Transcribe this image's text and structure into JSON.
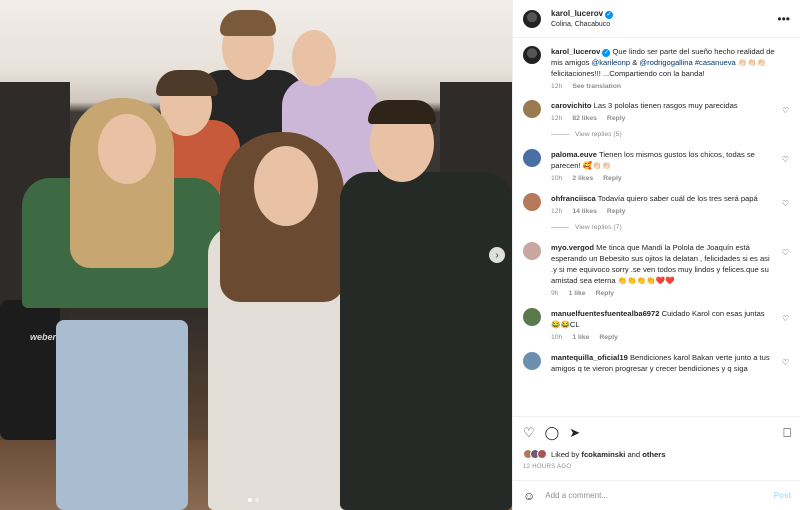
{
  "post": {
    "username": "karol_lucerov",
    "location": "Colina, Chacabuco",
    "caption": {
      "username": "karol_lucerov",
      "text_a": "Que lindo ser parte del sueño hecho realidad de mis amigos",
      "mention1": "@karileonp",
      "amp": "&",
      "mention2": "@rodrigogallina",
      "hashtag": "#casanueva",
      "text_b": "👏🏻👏🏻👏🏻 felicitaciones!!! ...Compartiendo con la banda!",
      "time": "12h",
      "see_translation": "See translation"
    }
  },
  "photo": {
    "grill_text": "weber",
    "next_icon": "chevron-right-icon"
  },
  "comments": [
    {
      "username": "carovichito",
      "text": "Las 3 pololas tienen rasgos muy parecidas",
      "time": "12h",
      "likes": "82 likes",
      "reply": "Reply",
      "view_replies": "View replies (5)",
      "avatar_color": "#9a7b4f"
    },
    {
      "username": "paloma.euve",
      "text": "Tienen los mismos gustos los chicos, todas se parecen! 🥰👏🏻👏🏻",
      "time": "10h",
      "likes": "2 likes",
      "reply": "Reply",
      "view_replies": "",
      "avatar_color": "#4a6fa5"
    },
    {
      "username": "ohfranciisca",
      "text": "Todavía quiero saber cuál de los tres será papá",
      "time": "12h",
      "likes": "14 likes",
      "reply": "Reply",
      "view_replies": "View replies (7)",
      "avatar_color": "#b57a5a"
    },
    {
      "username": "myo.vergod",
      "text": "Me tinca que Mandi la Polola de Joaquín está esperando un Bebesito sus ojitos la delatan , felicidades si es asi .y si me equivoco sorry .se ven todos muy lindos y felices.que su amistad sea eterna 👏👏👏👏❤️❤️",
      "time": "9h",
      "likes": "1 like",
      "reply": "Reply",
      "view_replies": "",
      "avatar_color": "#c9a7a0"
    },
    {
      "username": "manuelfuentesfuentealba6972",
      "text": "Cuidado Karol con esas juntas 😂😂CL",
      "time": "10h",
      "likes": "1 like",
      "reply": "Reply",
      "view_replies": "",
      "avatar_color": "#5b7a4c"
    },
    {
      "username": "mantequilla_oficial19",
      "text": "Bendiciones karol Bakan verte junto a tus amigos q te vieron progresar y crecer bendiciones y q siga",
      "time": "",
      "likes": "",
      "reply": "",
      "view_replies": "",
      "avatar_color": "#6c8fb0"
    }
  ],
  "actions": {
    "liked_by_prefix": "Liked by",
    "liked_by_user": "fcokaminski",
    "liked_by_suffix": "and",
    "liked_by_others": "others",
    "time_ago": "12 HOURS AGO"
  },
  "add_comment": {
    "placeholder": "Add a comment...",
    "post_label": "Post"
  },
  "colors": {
    "accent": "#0095f6",
    "muted": "#8e8e8e",
    "mention": "#00376b"
  }
}
